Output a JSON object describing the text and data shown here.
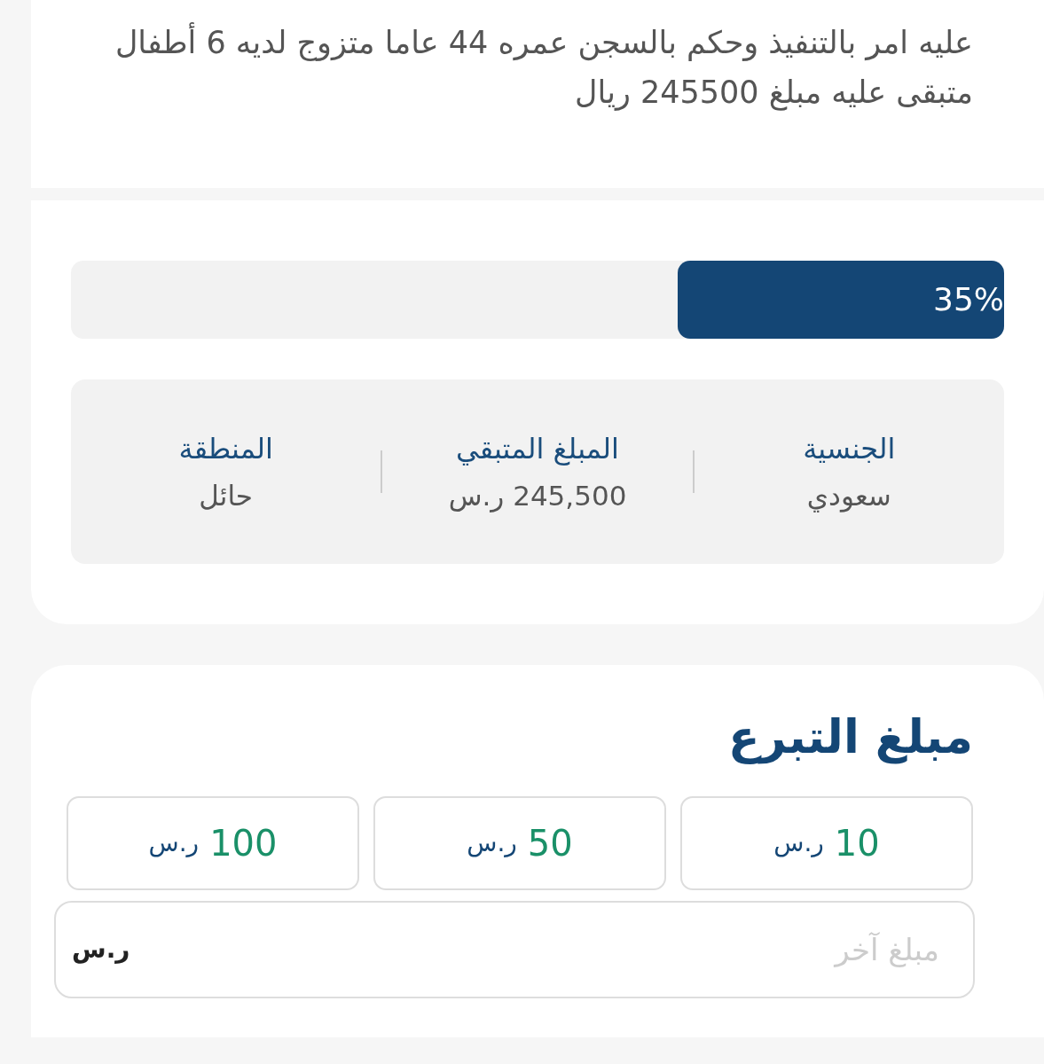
{
  "case": {
    "description": "عليه امر بالتنفيذ وحكم بالسجن عمره 44 عاما متزوج لديه 6 أطفال متبقى عليه مبلغ 245500 ريال"
  },
  "progress": {
    "level": 0.35,
    "label": "35%"
  },
  "stats": [
    {
      "label": "الجنسية",
      "value": "سعودي"
    },
    {
      "label": "المبلغ المتبقي",
      "value": "245,500",
      "currency": "ر.س"
    },
    {
      "label": "المنطقة",
      "value": "حائل"
    }
  ],
  "donation": {
    "title": "مبلغ التبرع",
    "presets": [
      {
        "amount": "10",
        "currency": "ر.س"
      },
      {
        "amount": "50",
        "currency": "ر.س"
      },
      {
        "amount": "100",
        "currency": "ر.س"
      }
    ],
    "other": {
      "placeholder": "مبلغ آخر",
      "currency": "ر.س"
    }
  }
}
